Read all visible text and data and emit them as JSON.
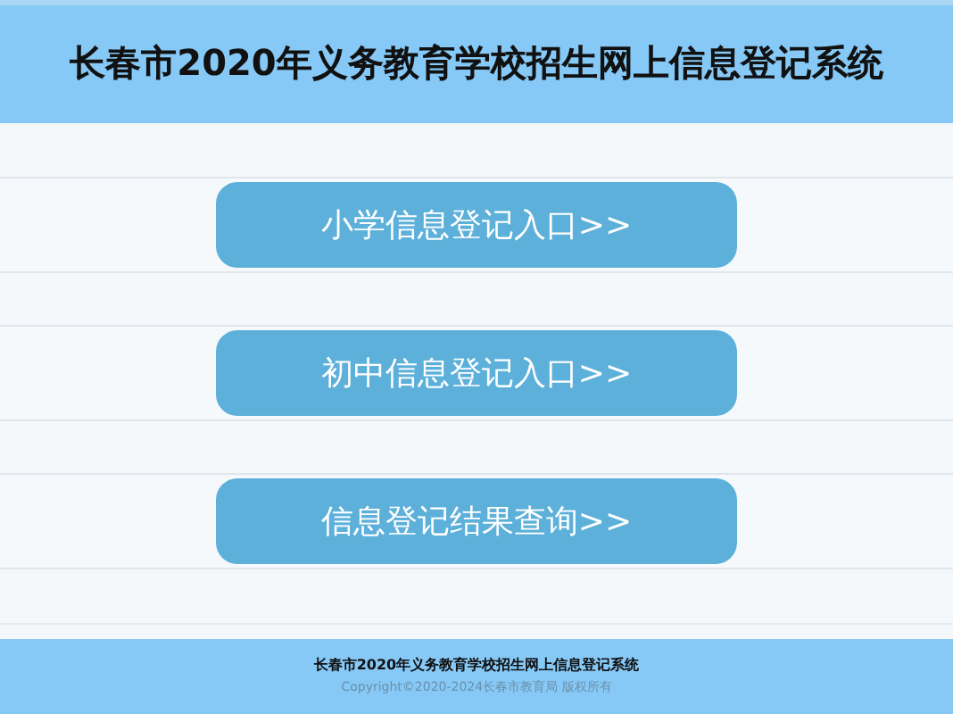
{
  "header": {
    "title": "长春市2020年义务教育学校招生网上信息登记系统"
  },
  "entries": [
    {
      "label": "小学信息登记入口>>"
    },
    {
      "label": "初中信息登记入口>>"
    },
    {
      "label": "信息登记结果查询>>"
    }
  ],
  "footer": {
    "title": "长春市2020年义务教育学校招生网上信息登记系统",
    "copyright": "Copyright©2020-2024长春市教育局 版权所有"
  }
}
